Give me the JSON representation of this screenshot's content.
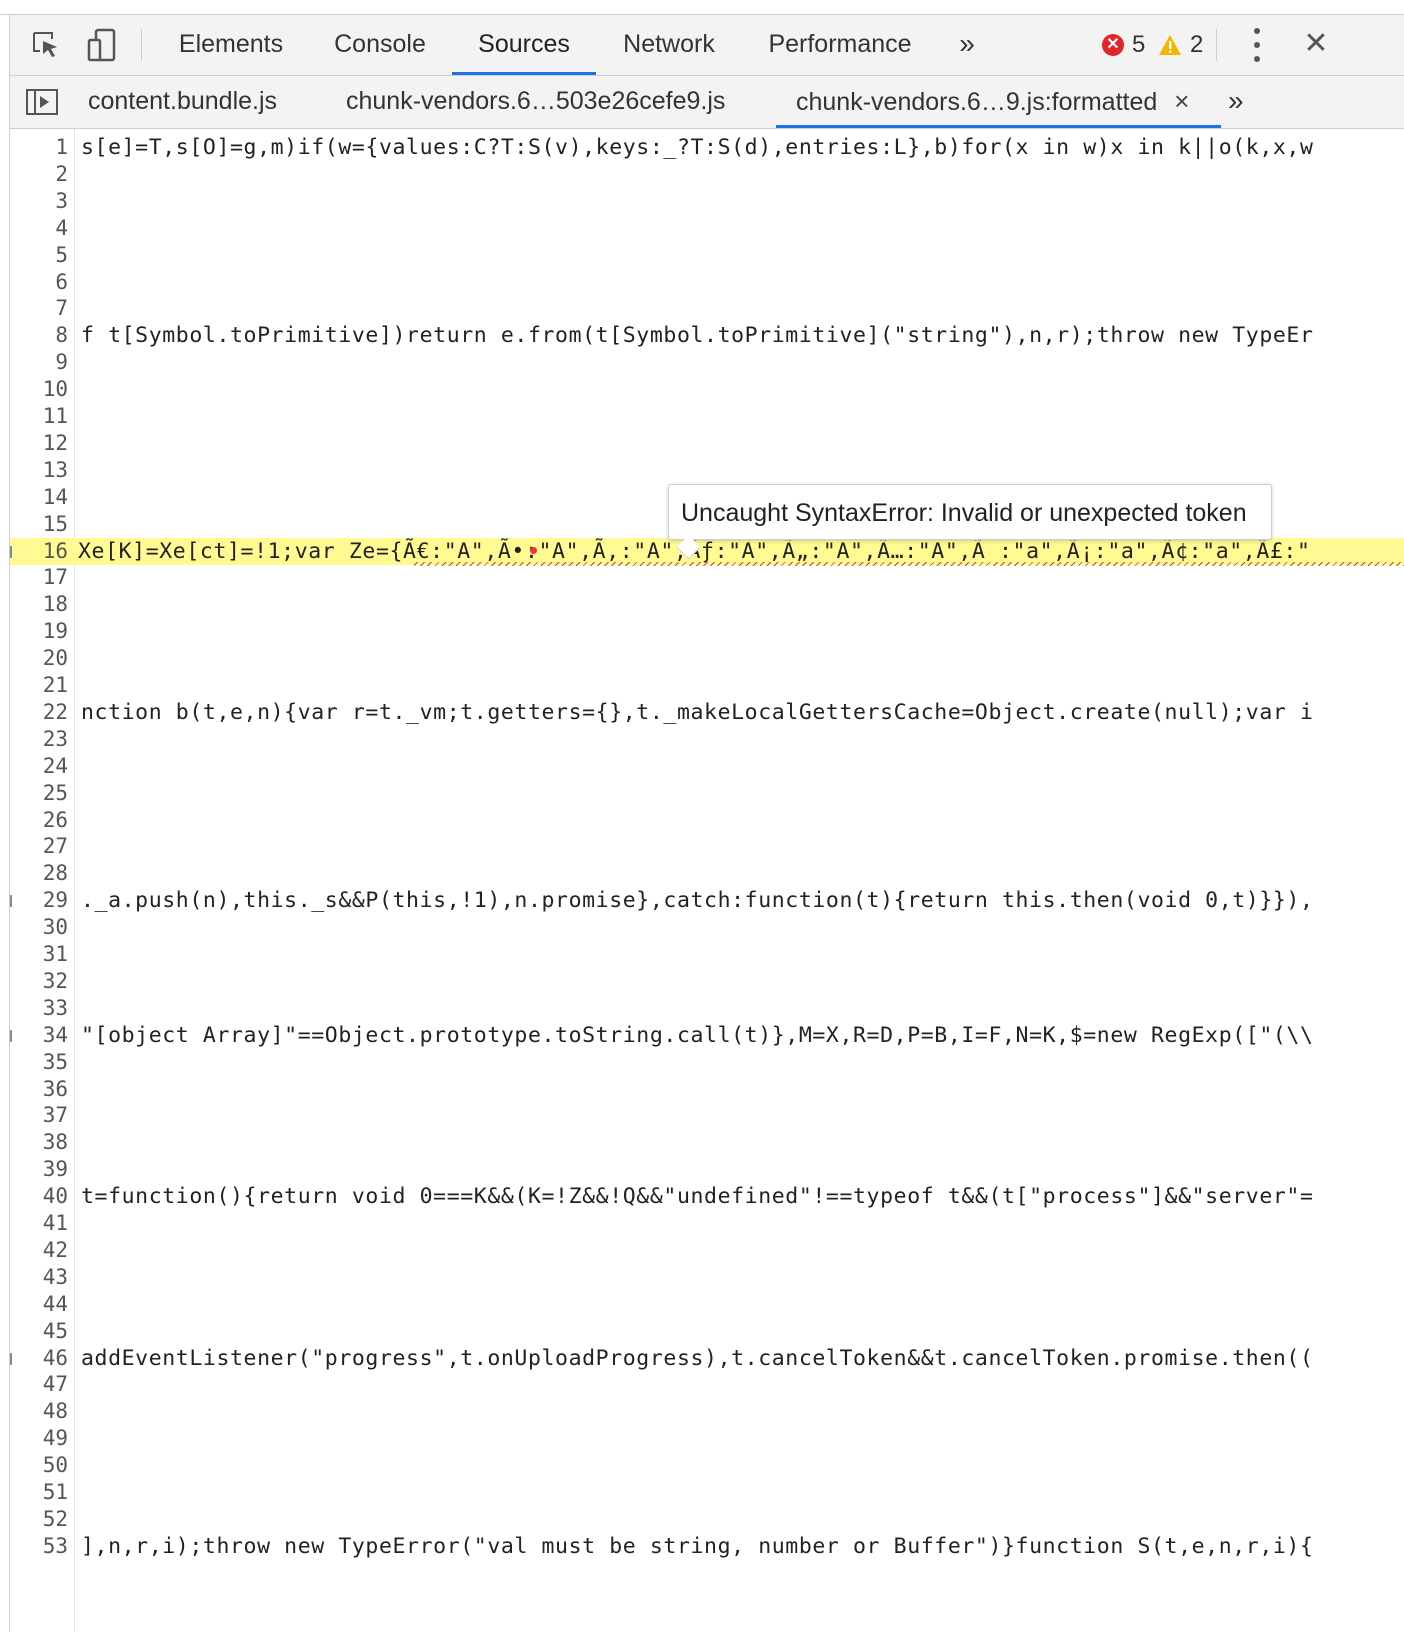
{
  "toolbar": {
    "tabs": [
      "Elements",
      "Console",
      "Sources",
      "Network",
      "Performance"
    ],
    "active_tab": "Sources",
    "more_tabs_label": "»",
    "errors_count": "5",
    "warnings_count": "2",
    "close_label": "✕"
  },
  "file_tabs": {
    "tabs": [
      "content.bundle.js",
      "chunk-vendors.6…503e26cefe9.js",
      "chunk-vendors.6…9.js:formatted"
    ],
    "active_tab": "chunk-vendors.6…9.js:formatted",
    "close_label": "×",
    "more_label": "»"
  },
  "editor": {
    "line_numbers": [
      "1",
      "2",
      "3",
      "4",
      "5",
      "6",
      "7",
      "8",
      "9",
      "10",
      "11",
      "12",
      "13",
      "14",
      "15",
      "16",
      "17",
      "18",
      "19",
      "20",
      "21",
      "22",
      "23",
      "24",
      "25",
      "26",
      "27",
      "28",
      "29",
      "30",
      "31",
      "32",
      "33",
      "34",
      "35",
      "36",
      "37",
      "38",
      "39",
      "40",
      "41",
      "42",
      "43",
      "44",
      "45",
      "46",
      "47",
      "48",
      "49",
      "50",
      "51",
      "52",
      "53"
    ],
    "highlighted_line": "16",
    "code": {
      "l1": "s[e]=T,s[O]=g,m)if(w={values:C?T:S(v),keys:_?T:S(d),entries:L},b)for(x in w)x in k||o(k,x,w",
      "l8": "f t[Symbol.toPrimitive])return e.from(t[Symbol.toPrimitive](\"string\"),n,r);throw new TypeEr",
      "l16": "Xe[K]=Xe[ct]=!1;var Ze={Ã€:\"A\",Ã•:\"A\",Ã‚:\"A\",Ãƒ:\"A\",Ã„:\"A\",Ã…:\"A\",Ã :\"a\",Ã¡:\"a\",Ã¢:\"a\",Ã£:\"",
      "l22": "nction b(t,e,n){var r=t._vm;t.getters={},t._makeLocalGettersCache=Object.create(null);var i",
      "l29": "._a.push(n),this._s&&P(this,!1),n.promise},catch:function(t){return this.then(void 0,t)}}),",
      "l34": "\"[object Array]\"==Object.prototype.toString.call(t)},M=X,R=D,P=B,I=F,N=K,$=new RegExp([\"(\\\\",
      "l40": "t=function(){return void 0===K&&(K=!Z&&!Q&&\"undefined\"!==typeof t&&(t[\"process\"]&&\"server\"=",
      "l46": "addEventListener(\"progress\",t.onUploadProgress),t.cancelToken&&t.cancelToken.promise.then((",
      "l53": "],n,r,i);throw new TypeError(\"val must be string, number or Buffer\")}function S(t,e,n,r,i){"
    }
  },
  "tooltip": {
    "text": "Uncaught SyntaxError: Invalid or unexpected token"
  }
}
